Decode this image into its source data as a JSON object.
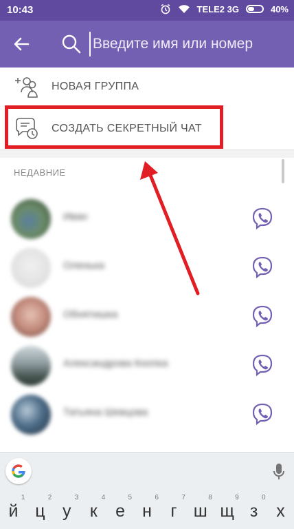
{
  "status_bar": {
    "time": "10:43",
    "carrier": "TELE2 3G",
    "battery": "40%"
  },
  "app_bar": {
    "search_placeholder": "Введите имя или номер"
  },
  "menu": {
    "new_group": "НОВАЯ ГРУППА",
    "secret_chat": "СОЗДАТЬ СЕКРЕТНЫЙ ЧАТ"
  },
  "recent": {
    "title": "НЕДАВНИЕ",
    "contacts": [
      {
        "name": "Иван"
      },
      {
        "name": "Оленька"
      },
      {
        "name": "Обнятишка"
      },
      {
        "name": "Александрова Кнопка"
      },
      {
        "name": "Татьяна Шевцова"
      }
    ]
  },
  "keyboard": {
    "keys": [
      {
        "ch": "й",
        "num": "1"
      },
      {
        "ch": "ц",
        "num": "2"
      },
      {
        "ch": "у",
        "num": "3"
      },
      {
        "ch": "к",
        "num": "4"
      },
      {
        "ch": "е",
        "num": "5"
      },
      {
        "ch": "н",
        "num": "6"
      },
      {
        "ch": "г",
        "num": "7"
      },
      {
        "ch": "ш",
        "num": "8"
      },
      {
        "ch": "щ",
        "num": "9"
      },
      {
        "ch": "з",
        "num": "0"
      },
      {
        "ch": "х",
        "num": ""
      }
    ]
  },
  "colors": {
    "status_bar": "#5f4a9f",
    "app_bar": "#7360b3",
    "highlight": "#e01e24",
    "viber_icon": "#7360b3"
  }
}
